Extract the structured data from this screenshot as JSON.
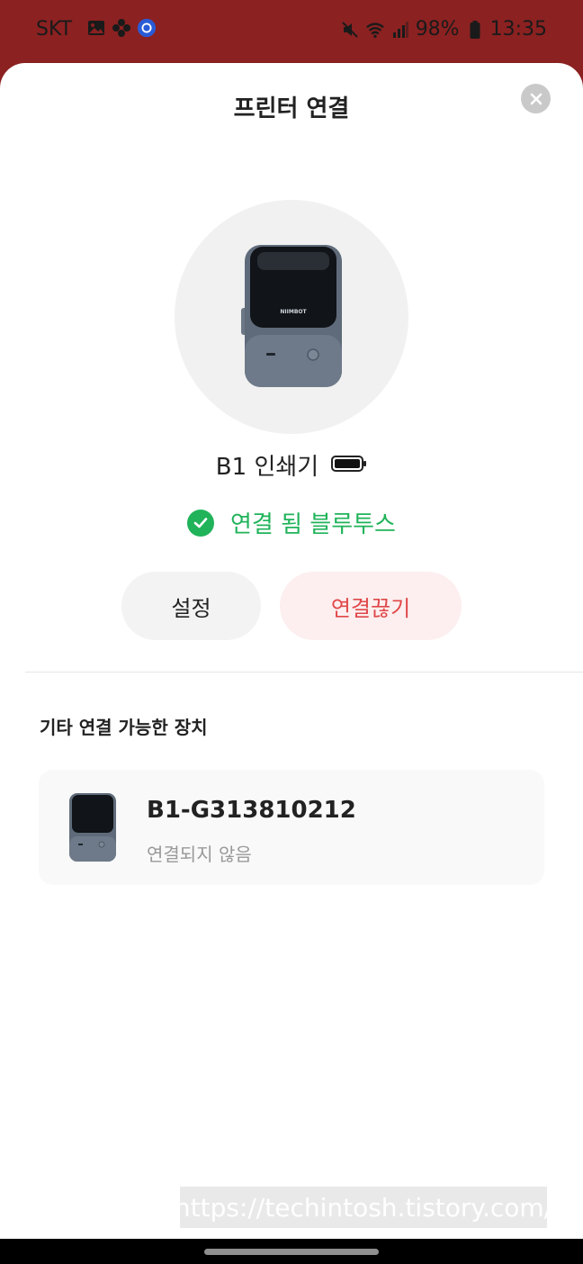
{
  "status_bar": {
    "carrier": "SKT",
    "battery": "98%",
    "time": "13:35",
    "left_icons": [
      "gallery-icon",
      "flower-icon",
      "app-badge-icon"
    ],
    "right_icons": [
      "mute-icon",
      "wifi-icon",
      "signal-icon",
      "battery-icon"
    ]
  },
  "sheet": {
    "title": "프린터 연결",
    "close_icon": "close-icon"
  },
  "printer": {
    "name": "B1 인쇄기",
    "brand": "NIIMBOT",
    "connection_status": "연결 됨 블루투스",
    "status_color": "#20b35a"
  },
  "actions": {
    "settings_label": "설정",
    "disconnect_label": "연결끊기",
    "disconnect_color": "#e0474a"
  },
  "other_devices": {
    "section_title": "기타 연결 가능한 장치",
    "items": [
      {
        "name": "B1-G313810212",
        "status": "연결되지 않음"
      }
    ]
  },
  "watermark": "https://techintosh.tistory.com/",
  "colors": {
    "status_bar_bg": "#8b2121",
    "accent_green": "#20b35a",
    "accent_red": "#e0474a"
  }
}
